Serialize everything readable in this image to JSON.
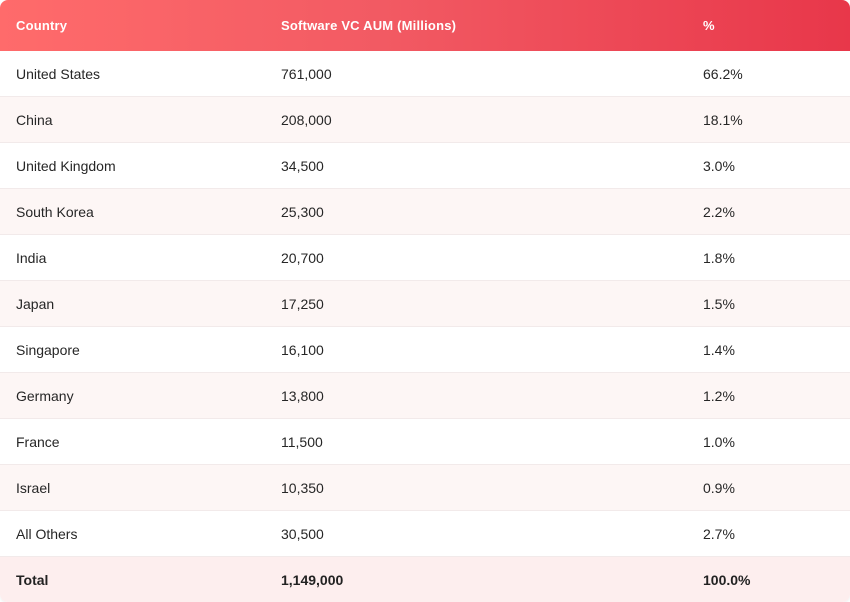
{
  "table": {
    "headers": {
      "country": "Country",
      "aum": "Software VC AUM (Millions)",
      "percent": "%"
    },
    "rows": [
      {
        "country": "United States",
        "aum": "761,000",
        "percent": "66.2%"
      },
      {
        "country": "China",
        "aum": "208,000",
        "percent": "18.1%"
      },
      {
        "country": "United Kingdom",
        "aum": "34,500",
        "percent": "3.0%"
      },
      {
        "country": "South Korea",
        "aum": "25,300",
        "percent": "2.2%"
      },
      {
        "country": "India",
        "aum": "20,700",
        "percent": "1.8%"
      },
      {
        "country": "Japan",
        "aum": "17,250",
        "percent": "1.5%"
      },
      {
        "country": "Singapore",
        "aum": "16,100",
        "percent": "1.4%"
      },
      {
        "country": "Germany",
        "aum": "13,800",
        "percent": "1.2%"
      },
      {
        "country": "France",
        "aum": "11,500",
        "percent": "1.0%"
      },
      {
        "country": "Israel",
        "aum": "10,350",
        "percent": "0.9%"
      },
      {
        "country": "All Others",
        "aum": "30,500",
        "percent": "2.7%"
      }
    ],
    "total": {
      "label": "Total",
      "aum": "1,149,000",
      "percent": "100.0%"
    }
  },
  "colors": {
    "header_gradient_start": "#ff6b6b",
    "header_gradient_end": "#e8374a",
    "row_alt": "#fdf6f5",
    "total_bg": "#fdeeee"
  }
}
